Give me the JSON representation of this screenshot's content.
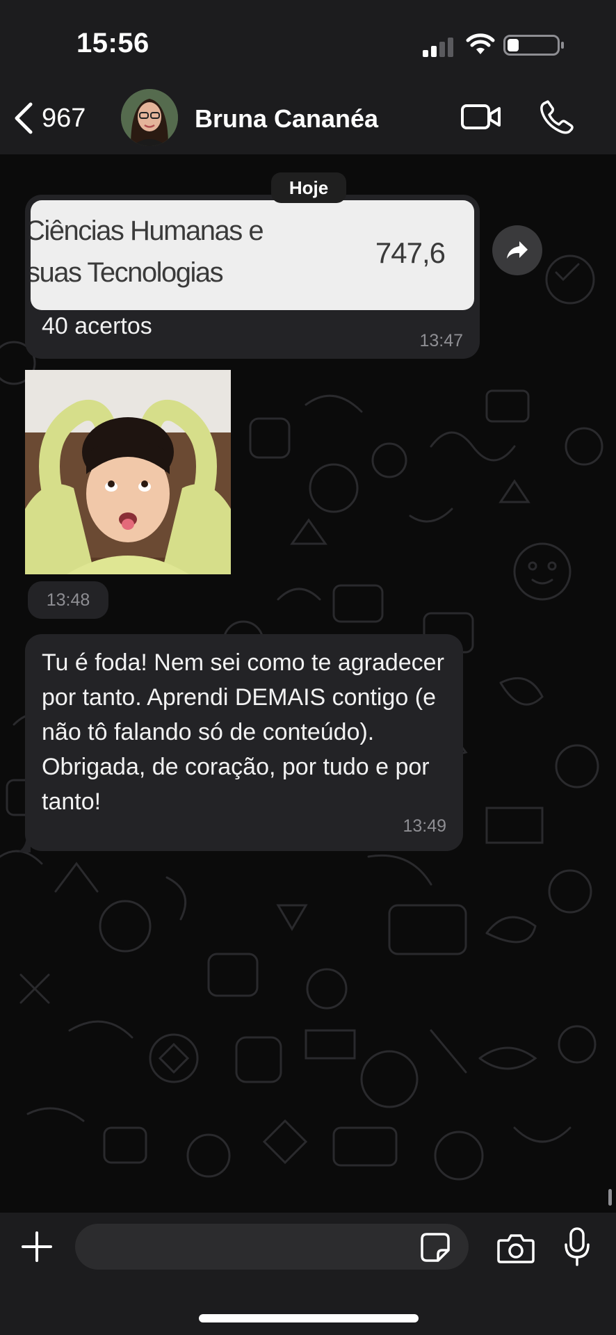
{
  "status_bar": {
    "time": "15:56"
  },
  "header": {
    "back_count": "967",
    "contact_name": "Bruna Cananéa"
  },
  "chat": {
    "date_label": "Hoje",
    "messages": [
      {
        "type": "image-with-caption",
        "image_text_line1": "Ciências Humanas e",
        "image_text_line2": "suas Tecnologias",
        "image_score": "747,6",
        "caption": "40 acertos",
        "time": "13:47"
      },
      {
        "type": "sticker",
        "time": "13:48"
      },
      {
        "type": "text",
        "text": "Tu é foda! Nem sei como te agradecer por tanto. Aprendi DEMAIS contigo (e não tô falando só de conteúdo). Obrigada, de coração, por tudo e por tanto!",
        "time": "13:49"
      }
    ]
  },
  "composer": {
    "input_value": ""
  },
  "icons": {
    "back": "chevron-left-icon",
    "video": "video-camera-icon",
    "call": "phone-icon",
    "forward": "forward-arrow-icon",
    "plus": "plus-icon",
    "sticker": "sticker-icon",
    "camera": "camera-icon",
    "mic": "microphone-icon"
  },
  "colors": {
    "header_bg": "#1c1c1e",
    "chat_bg": "#0b0b0b",
    "bubble_bg": "#232326",
    "timestamp": "#8e8e93"
  }
}
